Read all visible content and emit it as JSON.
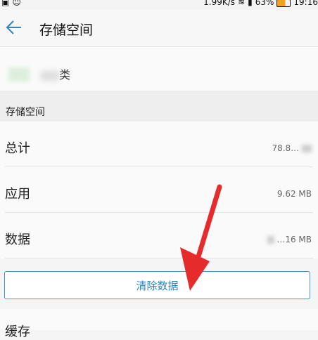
{
  "status_bar": {
    "network_speed": "1.99K/s",
    "battery_percent": "63%",
    "time": "19:16",
    "icons": [
      "notification-icon",
      "smiley-icon",
      "wifi-icon",
      "signal-icon",
      "battery-icon"
    ],
    "battery_level": 0.63,
    "battery_color": "#f2a31b"
  },
  "app_bar": {
    "title": "存储空间",
    "back_icon": "back-arrow-icon"
  },
  "app_info": {
    "name_visible_fragment": "类"
  },
  "section": {
    "title": "存储空间"
  },
  "rows": [
    {
      "label": "总计",
      "value": "78.8…"
    },
    {
      "label": "应用",
      "value": "9.62 MB"
    },
    {
      "label": "数据",
      "value": "…16 MB"
    }
  ],
  "clear_button": {
    "label": "清除数据"
  },
  "cache_row": {
    "label": "缓存",
    "value": ""
  },
  "colors": {
    "accent": "#2c87c2",
    "arrow": "#e52b2b"
  }
}
